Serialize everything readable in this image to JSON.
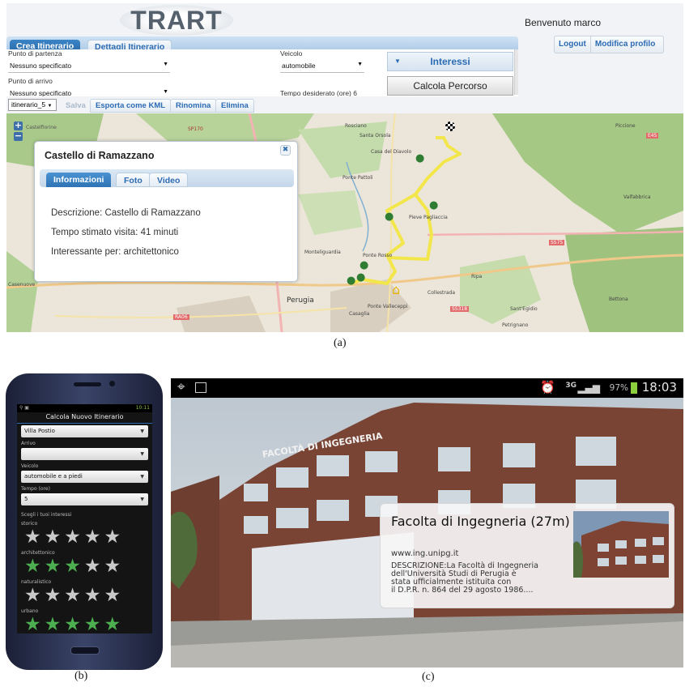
{
  "panel_a": {
    "logo": "TRART",
    "welcome": "Benvenuto marco",
    "header_buttons": [
      "Logout",
      "Modifica profilo"
    ],
    "tabs": [
      "Crea Itinerario",
      "Dettagli Itinerario"
    ],
    "form": {
      "partenza_label": "Punto di partenza",
      "partenza_value": "Nessuno specificato",
      "arrivo_label": "Punto di arrivo",
      "arrivo_value": "Nessuno specificato",
      "veicolo_label": "Veicolo",
      "veicolo_value": "automobile",
      "tempo_label": "Tempo desiderato (ore)",
      "tempo_value": "6",
      "interessi": "Interessi",
      "calcola": "Calcola Percorso"
    },
    "toolbar": {
      "itinerary": "itinerario_5",
      "buttons": [
        "Salva",
        "Esporta come KML",
        "Rinomina",
        "Elimina"
      ]
    },
    "map_labels": [
      "Castelfiorine",
      "SP170",
      "Rosciano",
      "Santa Orsola",
      "Casa del Diavolo",
      "Ponte Pattoli",
      "Pieve Pagliaccia",
      "Monteliguardia",
      "Ponte Rosso",
      "Perugia",
      "Casaglia",
      "Ponte Valleceppi",
      "Petrignano",
      "Collestrada",
      "Ripa",
      "Sant'Egidio",
      "Bettona",
      "SS318",
      "SS75",
      "Valfabbrica",
      "Piccione",
      "E45",
      "RA06",
      "Casenuove"
    ],
    "zoom": [
      "+",
      "−"
    ],
    "popup": {
      "title": "Castello di Ramazzano",
      "tabs": [
        "Informazioni",
        "Foto",
        "Video"
      ],
      "descrizione": "Descrizione: Castello di Ramazzano",
      "tempo": "Tempo stimato visita: 41 minuti",
      "interessante": "Interessante per: architettonico"
    },
    "caption": "(a)"
  },
  "panel_b": {
    "status": "10:11",
    "title": "Calcola Nuovo Itinerario",
    "partenza_value": "Villa Postio",
    "arrivo_label": "Arrivo",
    "arrivo_value": "",
    "veicolo_label": "Veicolo",
    "veicolo_value": "automobile e a piedi",
    "tempo_label": "Tempo (ore)",
    "tempo_value": "5",
    "interessi_label": "Scegli i tuoi interessi",
    "categories": [
      {
        "name": "storico",
        "rating": 0
      },
      {
        "name": "architettonico",
        "rating": 3
      },
      {
        "name": "naturalistico",
        "rating": 0
      },
      {
        "name": "urbano",
        "rating": 5
      }
    ],
    "caption": "(b)"
  },
  "panel_c": {
    "status": {
      "network": "3G",
      "battery": "97%",
      "time": "18:03"
    },
    "building_sign": "FACOLTÀ DI INGEGNERIA",
    "info": {
      "title": "Facolta di Ingegneria (27m)",
      "url": "www.ing.unipg.it",
      "description": [
        "DESCRIZIONE:La Facoltà di Ingegneria",
        "dell'Università Studi di Perugia è",
        "stata ufficialmente istituita con",
        "il D.P.R. n. 864 del 29 agosto 1986...."
      ]
    },
    "caption": "(c)"
  },
  "colors": {
    "accent": "#2c6bb3",
    "route": "#f3e43a",
    "star_on": "#4caf50",
    "star_off": "#c9c9c9"
  }
}
